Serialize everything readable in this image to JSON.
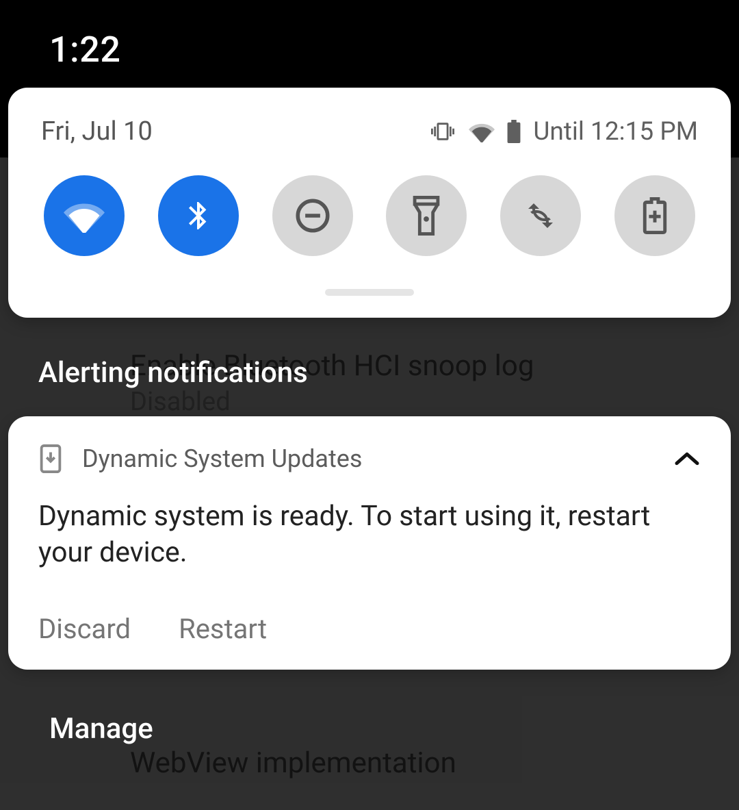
{
  "status_bar": {
    "time": "1:22"
  },
  "quick_settings": {
    "date": "Fri, Jul 10",
    "battery_until": "Until 12:15 PM",
    "tiles": [
      {
        "name": "wifi",
        "on": true
      },
      {
        "name": "bluetooth",
        "on": true
      },
      {
        "name": "dnd",
        "on": false
      },
      {
        "name": "flashlight",
        "on": false
      },
      {
        "name": "auto-rotate",
        "on": false
      },
      {
        "name": "battery-saver",
        "on": false
      }
    ]
  },
  "section_label": "Alerting notifications",
  "notification": {
    "app_name": "Dynamic System Updates",
    "body": "Dynamic system is ready. To start using it, restart your device.",
    "actions": {
      "discard": "Discard",
      "restart": "Restart"
    }
  },
  "manage_label": "Manage",
  "background_settings": {
    "line1": "Enable Bluetooth HCI snoop log",
    "line2": "Disabled",
    "line3": "WebView implementation"
  }
}
